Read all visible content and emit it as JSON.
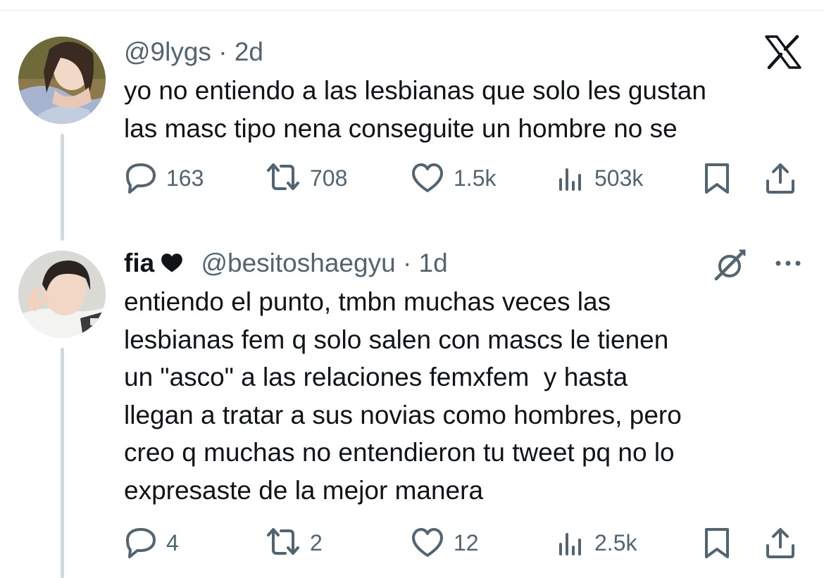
{
  "tweets": [
    {
      "handle": "@9lygs",
      "time": "2d",
      "text": "yo no entiendo a las lesbianas que solo les gustan\nlas masc tipo nena conseguite un hombre no se",
      "stats": {
        "replies": "163",
        "reposts": "708",
        "likes": "1.5k",
        "views": "503k"
      }
    },
    {
      "display_name": "fia",
      "handle": "@besitoshaegyu",
      "time": "1d",
      "text": "entiendo el punto, tmbn muchas veces las\nlesbianas fem q solo salen con mascs le tienen\nun \"asco\" a las relaciones femxfem  y hasta\nllegan a tratar a sus novias como hombres, pero\ncreo q muchas no entendieron tu tweet pq no lo\nexpresaste de la mejor manera",
      "stats": {
        "replies": "4",
        "reposts": "2",
        "likes": "12",
        "views": "2.5k"
      }
    }
  ],
  "separator": "·",
  "icons": {
    "brand": "x-logo-icon",
    "reply": "reply-bubble-icon",
    "repost": "repost-icon",
    "like": "heart-icon",
    "views": "views-bar-chart-icon",
    "bookmark": "bookmark-icon",
    "share": "share-upload-icon",
    "grok": "grok-icon",
    "more": "more-dots-icon",
    "name_emoji": "black-heart-icon"
  },
  "colors": {
    "text": "#0f1419",
    "muted": "#536471",
    "thread_line": "#cfd9de"
  }
}
